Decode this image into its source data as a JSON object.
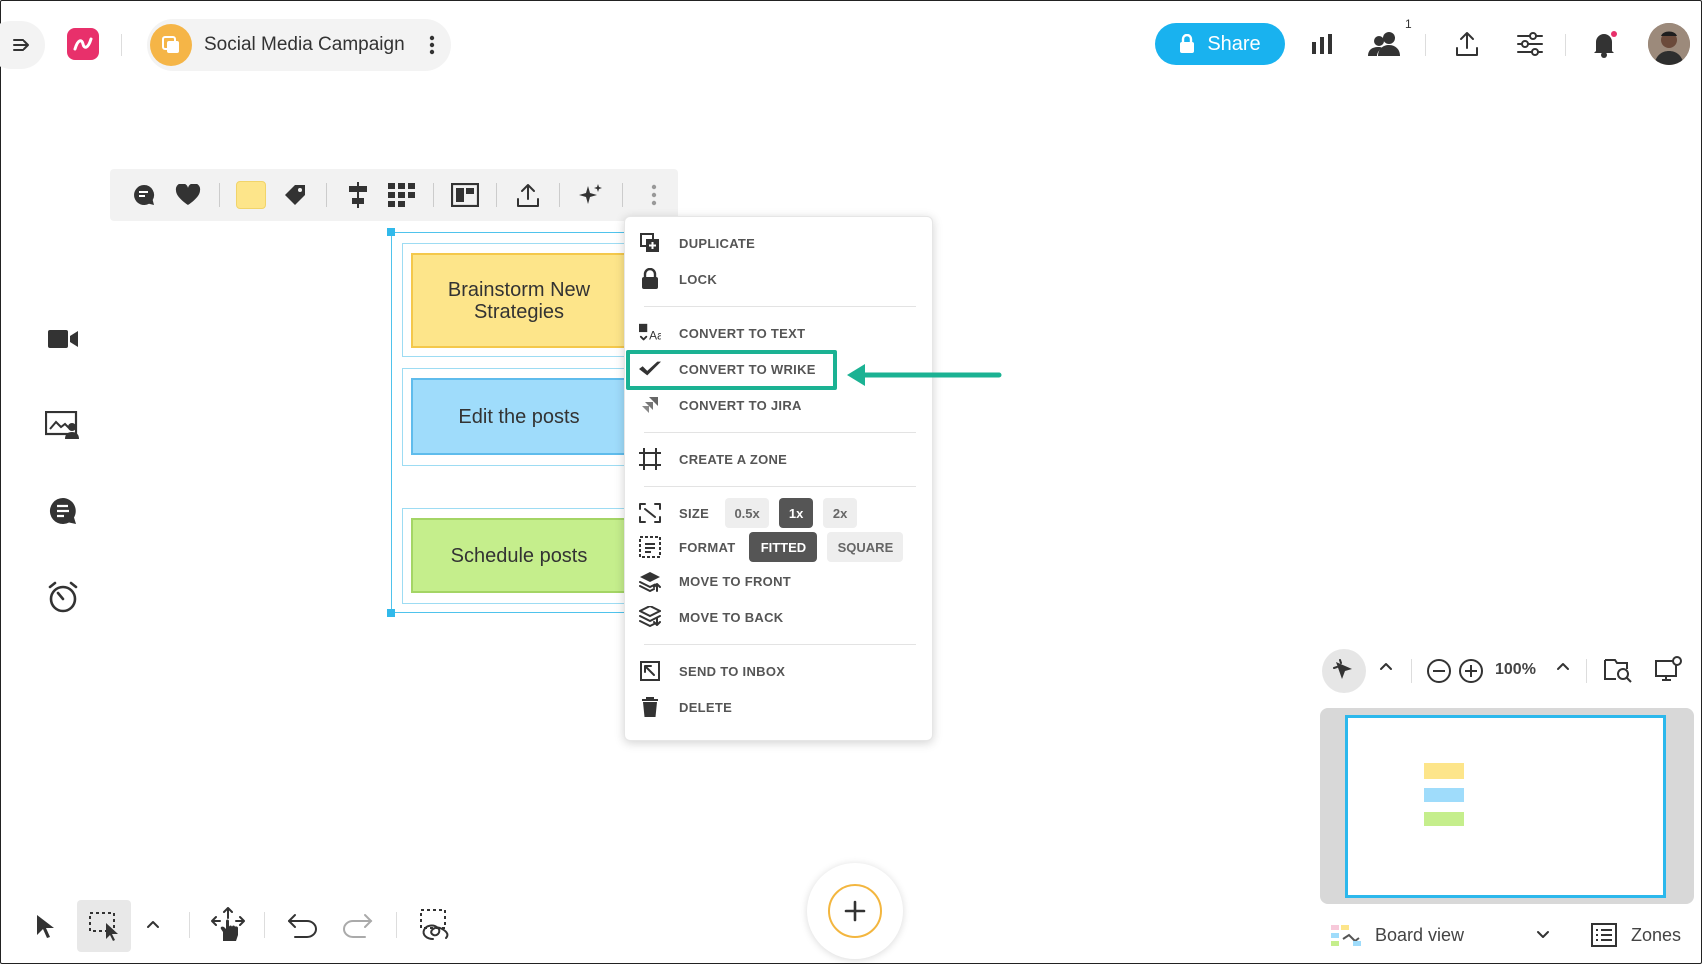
{
  "header": {
    "board_title": "Social Media Campaign",
    "share_label": "Share",
    "collaborators_count": "1"
  },
  "canvas": {
    "notes": [
      {
        "text": "Brainstorm New Strategies",
        "color": "#fde58a"
      },
      {
        "text": "Edit the posts",
        "color": "#9fdcfb"
      },
      {
        "text": "Schedule posts",
        "color": "#c5ee8c"
      }
    ]
  },
  "object_toolbar": {
    "icons": [
      "comment-icon",
      "heart-icon",
      "color-swatch",
      "tag-icon",
      "align-icon",
      "grid-icon",
      "zone-icon",
      "export-icon",
      "sparkle-icon",
      "more-icon"
    ],
    "swatch_color": "#fde58a"
  },
  "context_menu": {
    "duplicate": "DUPLICATE",
    "lock": "LOCK",
    "convert_text": "CONVERT TO TEXT",
    "convert_wrike": "CONVERT TO WRIKE",
    "convert_jira": "CONVERT TO JIRA",
    "create_zone": "CREATE A ZONE",
    "size_label": "SIZE",
    "size_options": [
      "0.5x",
      "1x",
      "2x"
    ],
    "size_selected": "1x",
    "format_label": "FORMAT",
    "format_options": [
      "FITTED",
      "SQUARE"
    ],
    "format_selected": "FITTED",
    "move_front": "MOVE TO FRONT",
    "move_back": "MOVE TO BACK",
    "send_inbox": "SEND TO INBOX",
    "delete": "DELETE"
  },
  "zoom": {
    "level": "100%"
  },
  "footer": {
    "board_view_label": "Board view",
    "zones_label": "Zones"
  },
  "colors": {
    "accent_share": "#19b2ef",
    "highlight": "#1bb293",
    "brand_logo": "#e8306b"
  }
}
